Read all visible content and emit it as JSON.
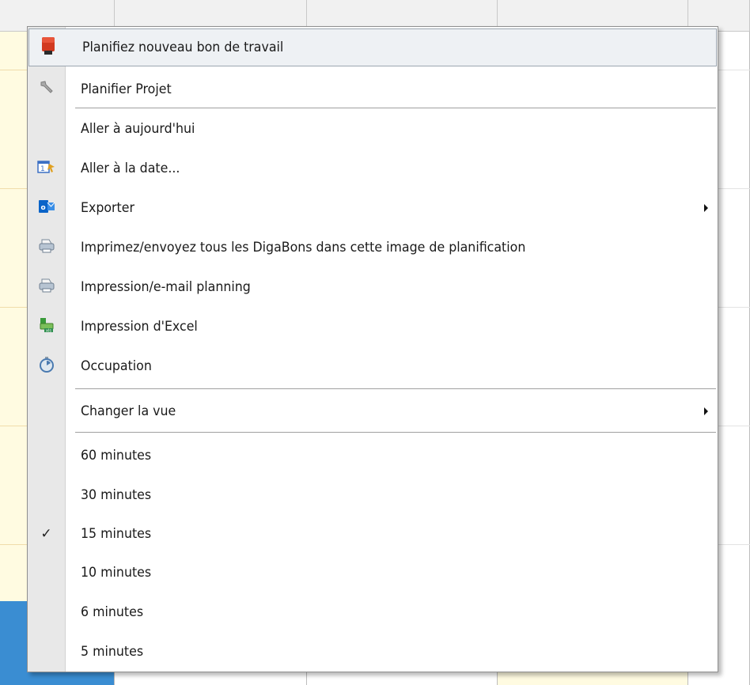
{
  "context_menu": {
    "items": [
      {
        "label": "Planifiez nouveau bon de travail",
        "icon": "workorder-icon",
        "highlighted": true
      },
      {
        "label": "Planifier Projet",
        "icon": "wrench-icon"
      },
      {
        "label": "Aller à aujourd'hui",
        "icon": null
      },
      {
        "label": "Aller à la date...",
        "icon": "calendar-goto-icon"
      },
      {
        "label": "Exporter",
        "icon": "outlook-icon",
        "submenu": true
      },
      {
        "label": "Imprimez/envoyez tous les DigaBons dans cette image de planification",
        "icon": "printer-icon"
      },
      {
        "label": "Impression/e-mail planning",
        "icon": "printer-icon"
      },
      {
        "label": "Impression d'Excel",
        "icon": "excel-print-icon"
      },
      {
        "label": "Occupation",
        "icon": "stopwatch-icon"
      },
      {
        "label": "Changer la vue",
        "icon": null,
        "submenu": true
      },
      {
        "label": "60 minutes"
      },
      {
        "label": "30 minutes"
      },
      {
        "label": "15 minutes",
        "checked": true
      },
      {
        "label": "10 minutes"
      },
      {
        "label": "6 minutes"
      },
      {
        "label": "5 minutes"
      }
    ],
    "check_glyph": "✓"
  },
  "colors": {
    "menu_gutter": "#e8e8e8",
    "highlight_bg": "#eef1f4",
    "schedule_yellow": "#fffbe1",
    "schedule_blue": "#3a8dd2"
  }
}
